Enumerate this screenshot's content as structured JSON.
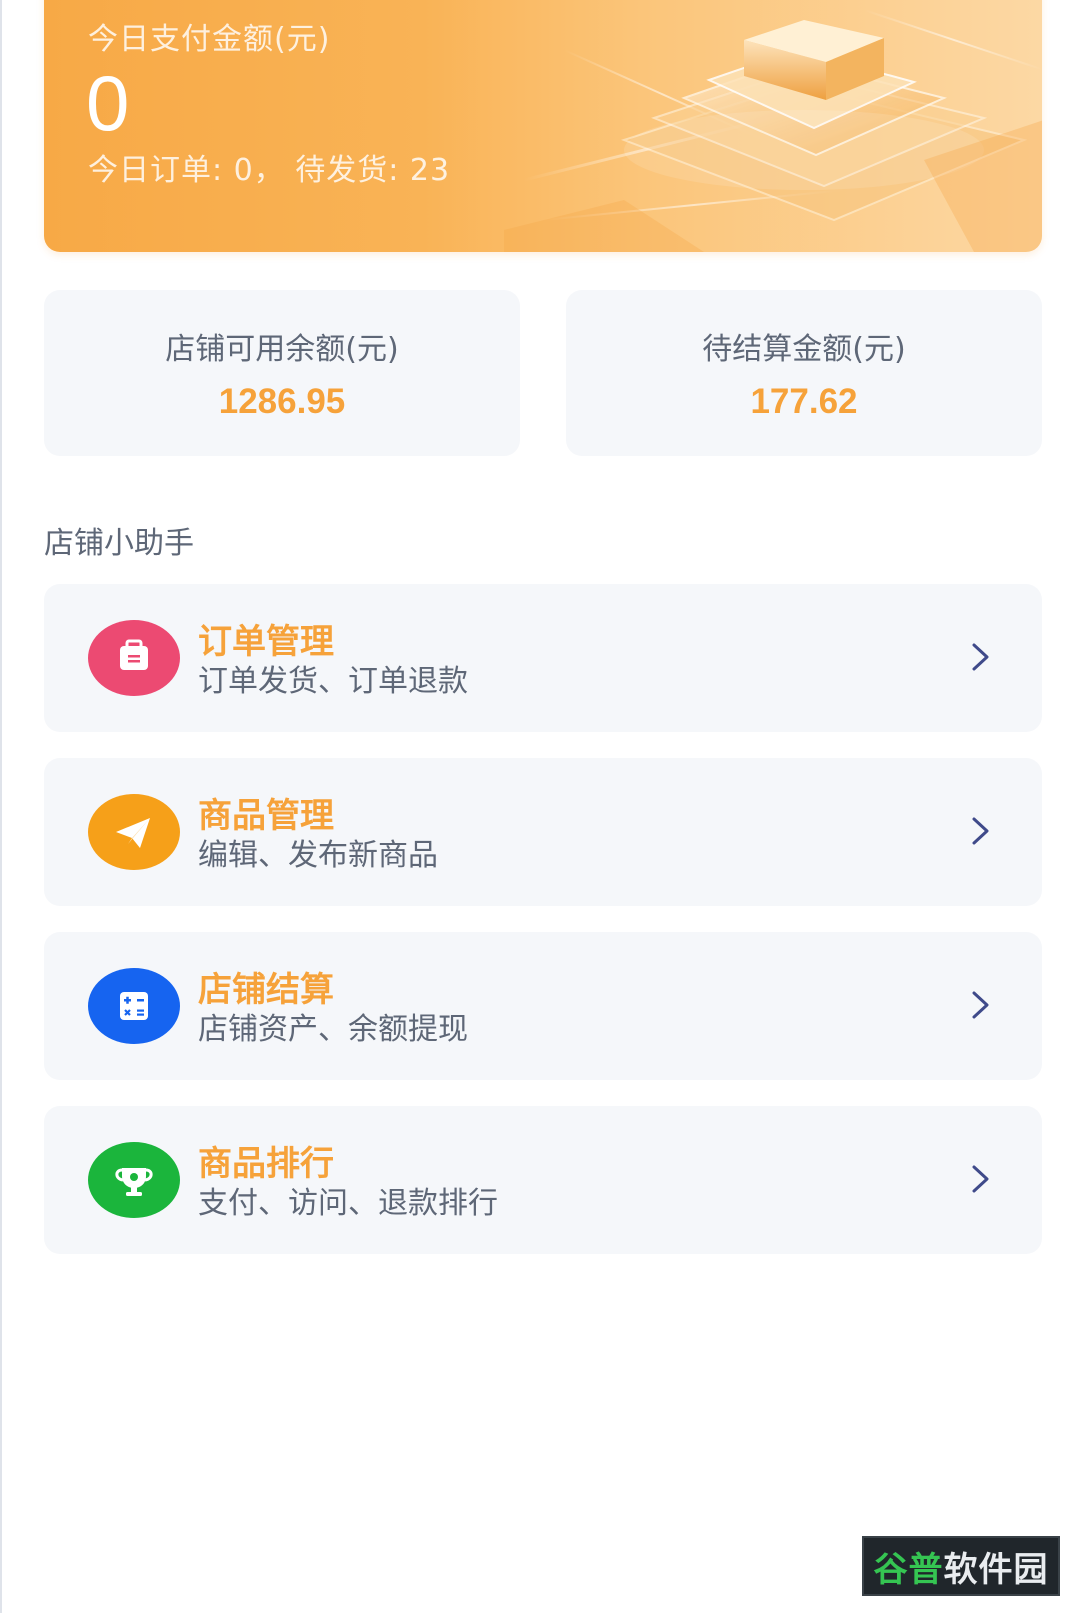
{
  "hero": {
    "label": "今日支付金额(元)",
    "amount": "0",
    "subtitle": "今日订单: 0，  待发货: 23"
  },
  "balances": [
    {
      "label": "店铺可用余额(元)",
      "value": "1286.95"
    },
    {
      "label": "待结算金额(元)",
      "value": "177.62"
    }
  ],
  "section_title": "店铺小助手",
  "menu": [
    {
      "title": "订单管理",
      "desc": "订单发货、订单退款",
      "icon": "briefcase-icon",
      "color": "#ec4a72"
    },
    {
      "title": "商品管理",
      "desc": "编辑、发布新商品",
      "icon": "paper-plane-icon",
      "color": "#f6a019"
    },
    {
      "title": "店铺结算",
      "desc": "店铺资产、余额提现",
      "icon": "calculator-icon",
      "color": "#1664f0"
    },
    {
      "title": "商品排行",
      "desc": "支付、访问、退款排行",
      "icon": "trophy-icon",
      "color": "#1bb53c"
    }
  ],
  "watermark": {
    "part1": "谷普",
    "part2": "软件园"
  },
  "colors": {
    "accent": "#f6a23a",
    "text_secondary": "#5e6777",
    "card_bg": "#f5f7fa",
    "chevron": "#3f4a8a"
  }
}
